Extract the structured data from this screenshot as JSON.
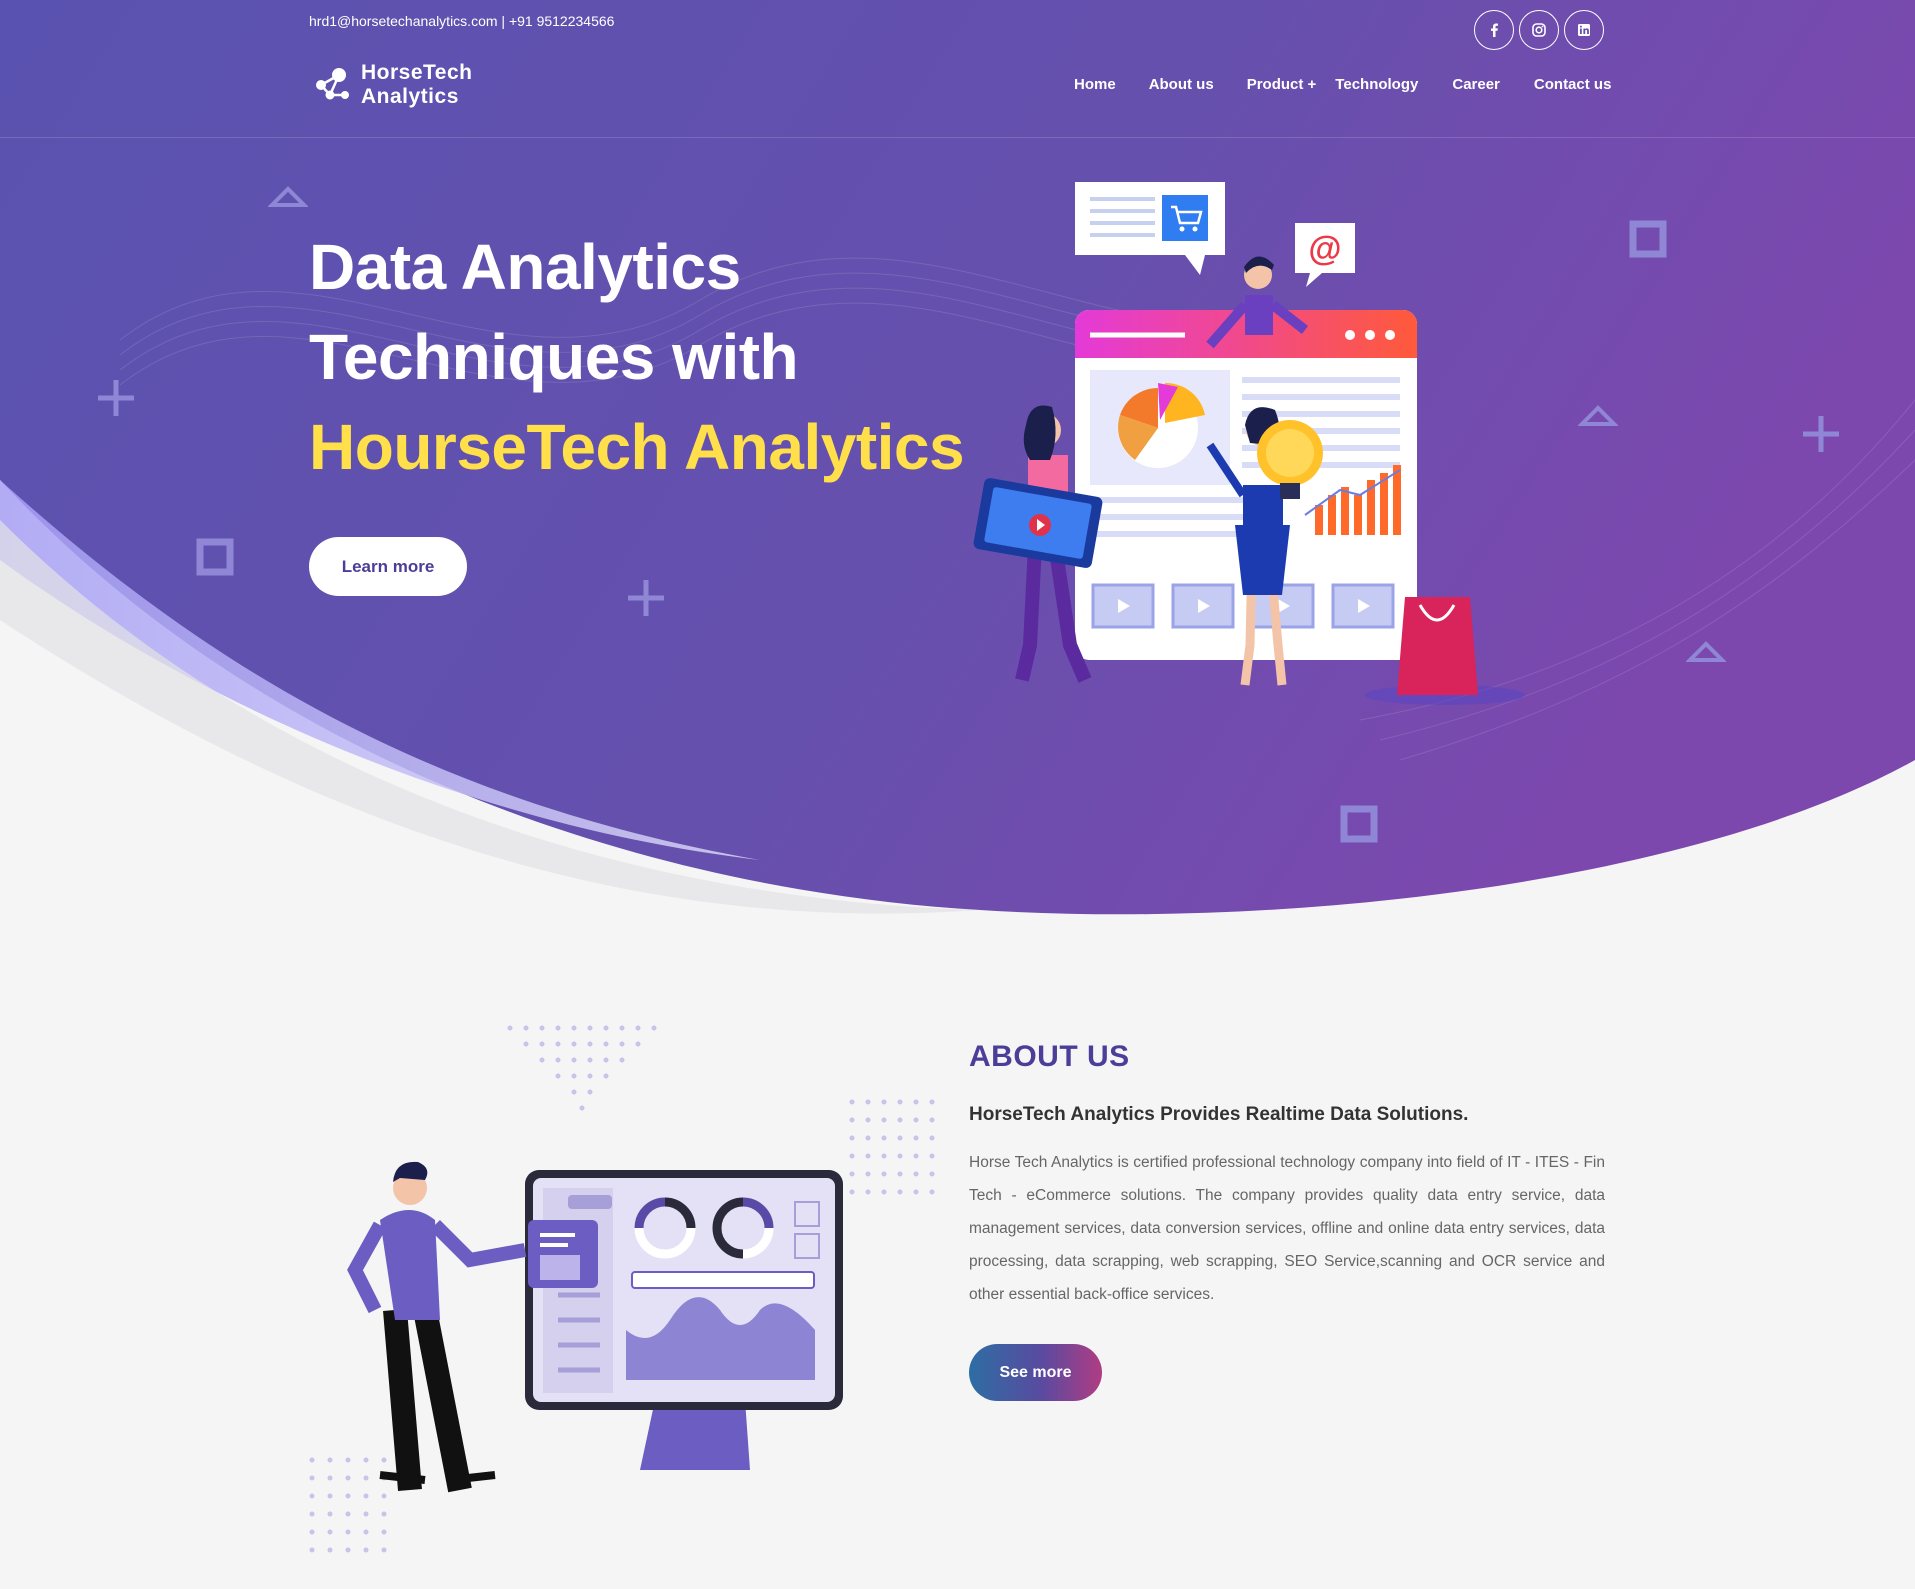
{
  "topbar": {
    "contact": "hrd1@horsetechanalytics.com | +91 9512234566",
    "socials": [
      {
        "name": "facebook-icon"
      },
      {
        "name": "instagram-icon"
      },
      {
        "name": "linkedin-icon"
      }
    ]
  },
  "logo": {
    "line1": "HorseTech",
    "line2": "Analytics"
  },
  "nav": {
    "items": [
      "Home",
      "About us",
      "Product +",
      "Technology",
      "Career",
      "Contact us"
    ]
  },
  "hero": {
    "line1": "Data Analytics",
    "line2": "Techniques with",
    "line3": "HourseTech Analytics",
    "button": "Learn more"
  },
  "about": {
    "heading": "ABOUT US",
    "subheading": "HorseTech Analytics Provides Realtime Data Solutions.",
    "body": "Horse Tech Analytics is certified professional technology company into field of IT - ITES - Fin Tech - eCommerce solutions. The company provides quality data entry service, data management services, data conversion services, offline and online data entry services, data processing, data scrapping, web scrapping, SEO Service,scanning and OCR service and other essential back-office services.",
    "button": "See more"
  },
  "colors": {
    "hero_start": "#5c4fae",
    "hero_end": "#7a4ab0",
    "accent_yellow": "#ffe04a",
    "heading_purple": "#4b3e98"
  }
}
